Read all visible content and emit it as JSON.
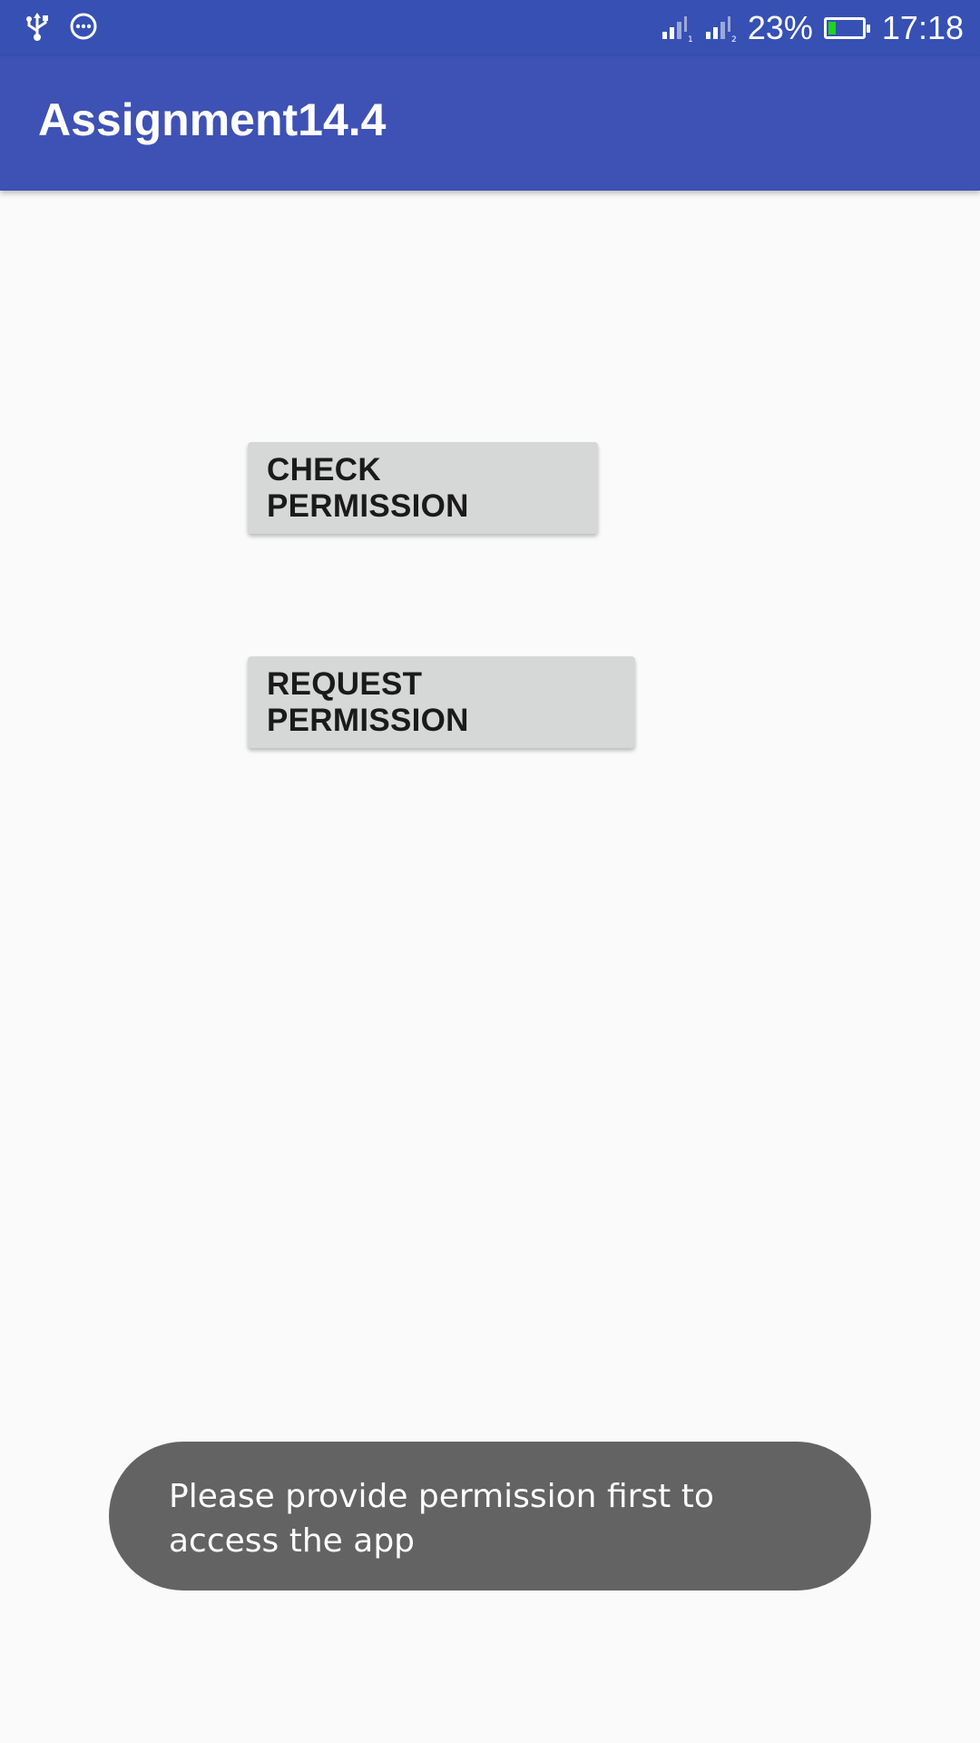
{
  "status_bar": {
    "left_icons": [
      "usb-icon",
      "more-circle-icon"
    ],
    "right_icons": [
      "signal-sim1-icon",
      "signal-sim2-icon",
      "battery-icon"
    ],
    "sim1_indicator": "1",
    "sim2_indicator": "2",
    "battery_percent": "23%",
    "battery_level": 0.23,
    "battery_color": "#1ed41e",
    "time": "17:18"
  },
  "app_bar": {
    "title": "Assignment14.4",
    "color": "#3e51b5"
  },
  "main": {
    "check_permission_label": "CHECK PERMISSION",
    "request_permission_label": "REQUEST PERMISSION"
  },
  "toast": {
    "message": "Please provide permission first to access the app"
  }
}
